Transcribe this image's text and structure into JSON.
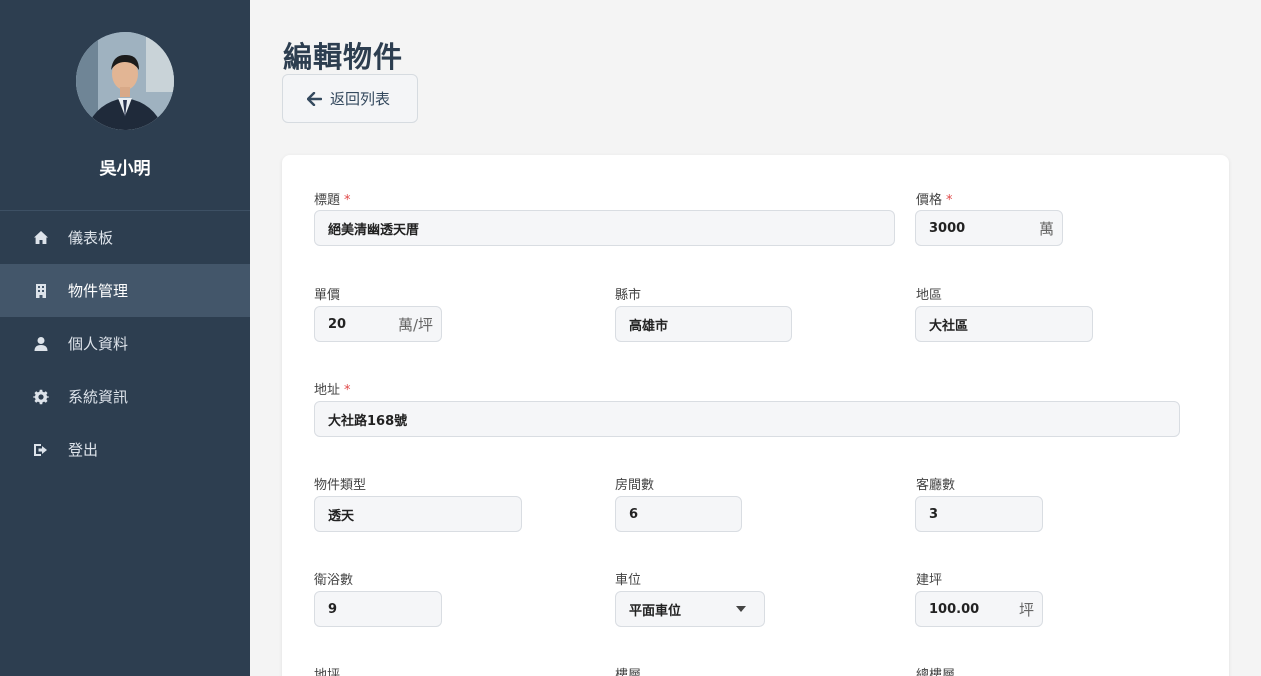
{
  "user": {
    "name": "吳小明"
  },
  "nav": [
    {
      "label": "儀表板",
      "icon": "home-icon"
    },
    {
      "label": "物件管理",
      "icon": "building-icon",
      "active": true
    },
    {
      "label": "個人資料",
      "icon": "user-icon"
    },
    {
      "label": "系統資訊",
      "icon": "gear-icon"
    },
    {
      "label": "登出",
      "icon": "logout-icon"
    }
  ],
  "page": {
    "title": "編輯物件",
    "back_label": "返回列表"
  },
  "form": {
    "title": {
      "label": "標題",
      "required_mark": "*",
      "value": "絕美清幽透天厝"
    },
    "price": {
      "label": "價格",
      "required_mark": "*",
      "value": "3000",
      "unit": "萬"
    },
    "unit_price": {
      "label": "單價",
      "value": "20",
      "unit": "萬/坪"
    },
    "city": {
      "label": "縣市",
      "value": "高雄市"
    },
    "district": {
      "label": "地區",
      "value": "大社區"
    },
    "address": {
      "label": "地址",
      "required_mark": "*",
      "value": "大社路168號"
    },
    "property_type": {
      "label": "物件類型",
      "value": "透天"
    },
    "rooms": {
      "label": "房間數",
      "value": "6"
    },
    "living_rooms": {
      "label": "客廳數",
      "value": "3"
    },
    "bathrooms": {
      "label": "衛浴數",
      "value": "9"
    },
    "parking": {
      "label": "車位",
      "value": "平面車位"
    },
    "building_area": {
      "label": "建坪",
      "value": "100.00",
      "unit": "坪"
    },
    "land_area": {
      "label": "地坪"
    },
    "floor": {
      "label": "樓層"
    },
    "total_floors": {
      "label": "總樓層"
    }
  },
  "colors": {
    "sidebar": "#2d3e50",
    "sidebar_active": "#43566a",
    "required": "#e04848"
  }
}
